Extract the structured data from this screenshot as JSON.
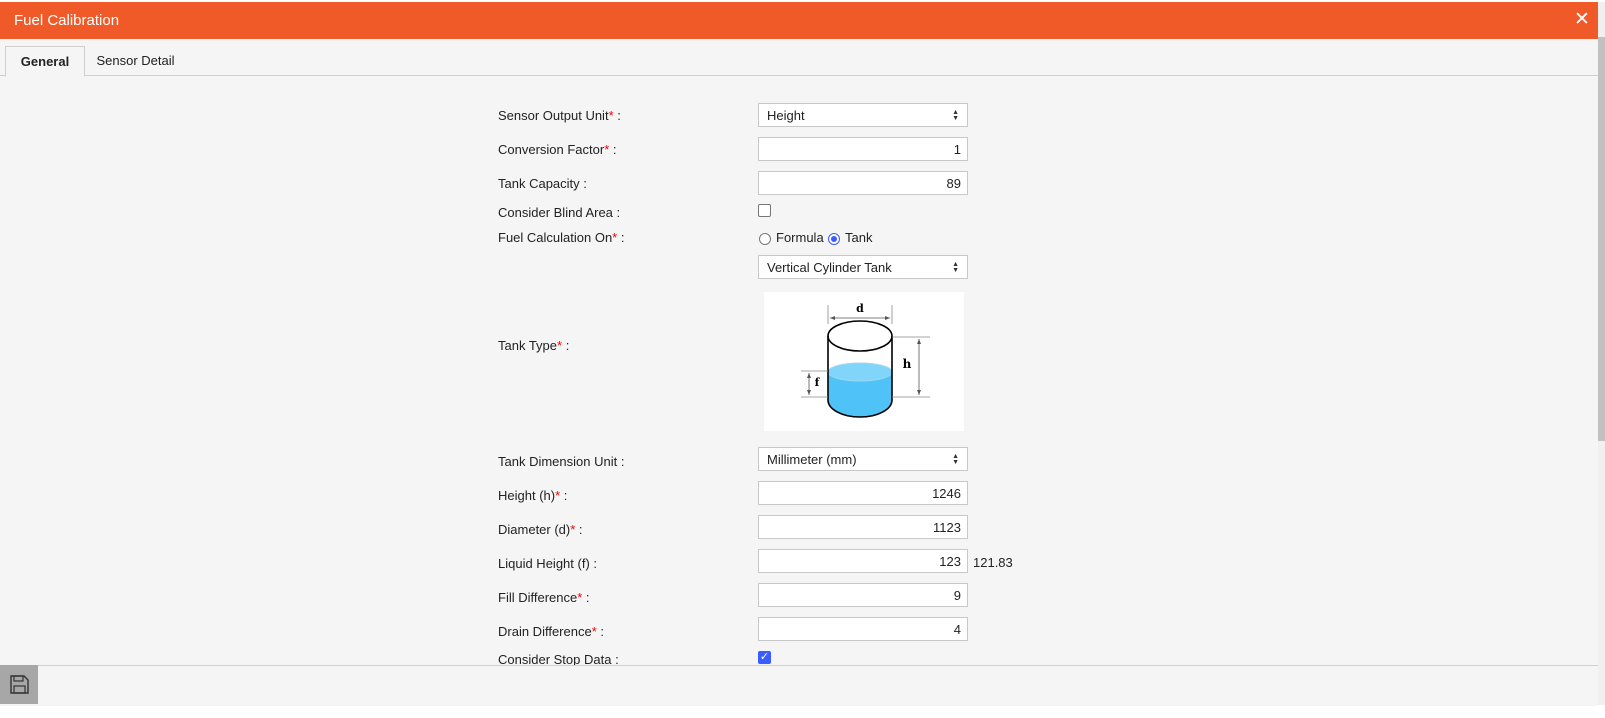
{
  "dialog": {
    "title": "Fuel Calibration",
    "close_label": "✕"
  },
  "tabs": [
    {
      "label": "General",
      "active": true
    },
    {
      "label": "Sensor Detail",
      "active": false
    }
  ],
  "form": {
    "sensor_output_unit": {
      "label": "Sensor Output Unit",
      "value": "Height",
      "required": true
    },
    "conversion_factor": {
      "label": "Conversion Factor",
      "value": "1",
      "required": true
    },
    "tank_capacity": {
      "label": "Tank Capacity",
      "value": "89"
    },
    "consider_blind_area": {
      "label": "Consider Blind Area",
      "checked": false
    },
    "fuel_calculation_on": {
      "label": "Fuel Calculation On",
      "required": true,
      "options": [
        "Formula",
        "Tank"
      ],
      "selected": "Tank"
    },
    "tank_type": {
      "label": "Tank Type",
      "required": true,
      "value": "Vertical Cylinder Tank",
      "diagram_labels": {
        "d": "d",
        "h": "h",
        "f": "f"
      }
    },
    "tank_dimension_unit": {
      "label": "Tank Dimension Unit",
      "value": "Millimeter (mm)"
    },
    "height": {
      "label": "Height (h)",
      "value": "1246",
      "required": true
    },
    "diameter": {
      "label": "Diameter (d)",
      "value": "1123",
      "required": true
    },
    "liquid_height": {
      "label": "Liquid Height (f)",
      "value": "123",
      "extra": "121.83"
    },
    "fill_difference": {
      "label": "Fill Difference",
      "value": "9",
      "required": true
    },
    "drain_difference": {
      "label": "Drain Difference",
      "value": "4",
      "required": true
    },
    "consider_stop_data": {
      "label": "Consider Stop Data",
      "checked": true
    }
  },
  "common": {
    "required_mark": "*",
    "colon": " :",
    "check_mark": "✓"
  },
  "colors": {
    "header": "#f05a28",
    "water": "#4fc3f7",
    "accent": "#3b5cff",
    "required": "#e00000"
  },
  "icons": {
    "save": "save-icon",
    "close": "close-icon"
  }
}
